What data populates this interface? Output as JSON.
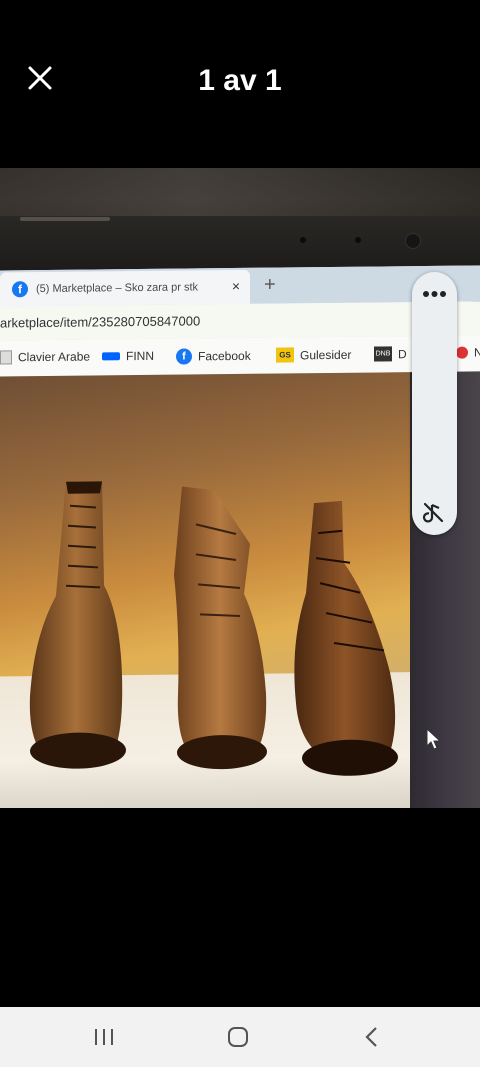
{
  "viewer": {
    "counter": "1 av 1",
    "close_icon": "close-icon"
  },
  "photo": {
    "browser": {
      "tab_title": "(5) Marketplace – Sko zara pr stk",
      "tab_close": "×",
      "new_tab": "+",
      "url": "arketplace/item/235280705847000",
      "bookmarks": [
        {
          "label": "Clavier Arabe",
          "icon": "page-icon"
        },
        {
          "label": "FINN",
          "icon": "finn-icon"
        },
        {
          "label": "Facebook",
          "icon": "facebook-icon"
        },
        {
          "label": "Gulesider",
          "icon": "gulesider-icon"
        },
        {
          "label": "D",
          "icon": "dnb-icon"
        },
        {
          "label": "N",
          "icon": "n-icon"
        }
      ],
      "gulesider_badge": "GS",
      "dnb_badge": "DNB"
    }
  },
  "side_panel": {
    "more_icon": "more-horizontal-icon",
    "sound_icon": "sound-off-icon"
  },
  "navbar": {
    "recents_icon": "recent-apps-icon",
    "home_icon": "home-icon",
    "back_icon": "back-icon"
  },
  "colors": {
    "background": "#000000",
    "navbar": "#f2f2f2",
    "panel": "#eceff1"
  }
}
